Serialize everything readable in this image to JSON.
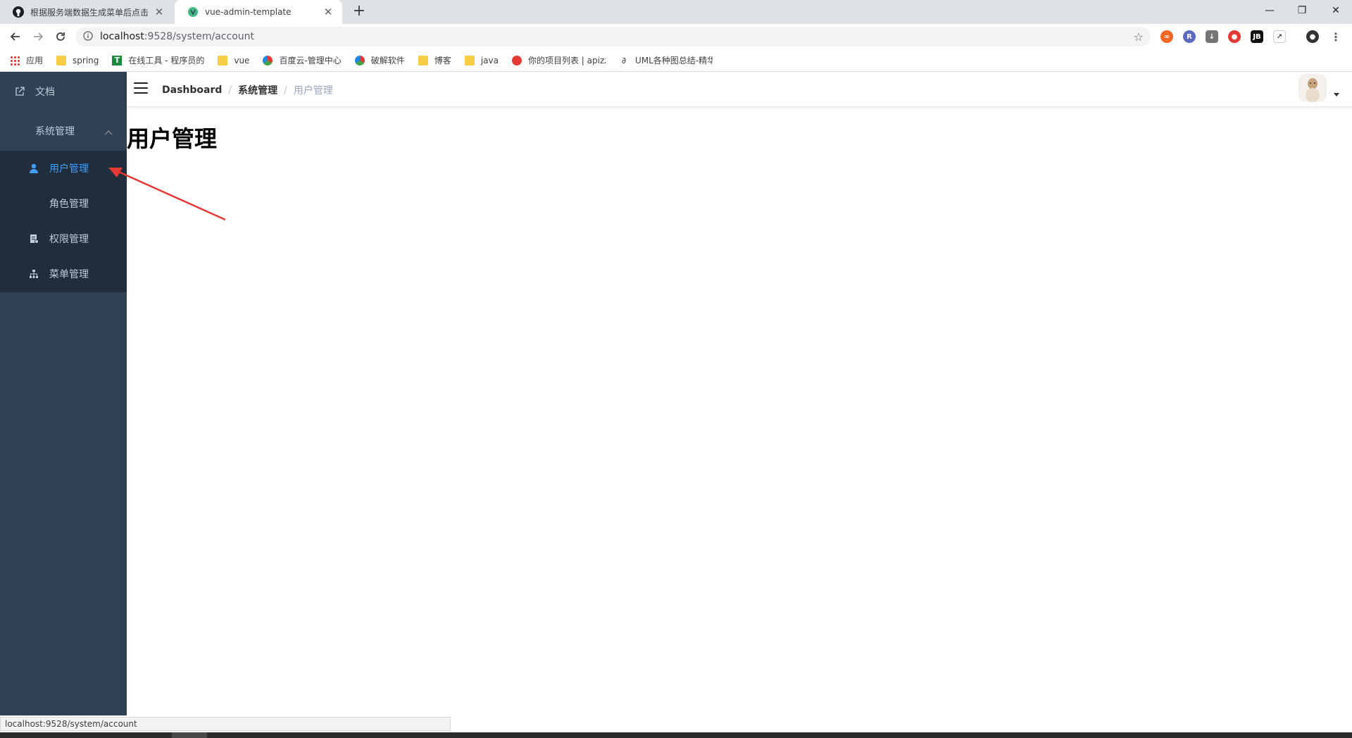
{
  "browser": {
    "tabs": [
      {
        "title": "根据服务端数据生成菜单后点击",
        "active": false
      },
      {
        "title": "vue-admin-template",
        "active": true
      }
    ],
    "url_host": "localhost",
    "url_path": ":9528/system/account",
    "bookmarks": [
      {
        "label": "应用",
        "icon": "apps-grid-icon"
      },
      {
        "label": "spring",
        "icon": "folder-icon"
      },
      {
        "label": "在线工具 - 程序员的",
        "icon": "tool-icon"
      },
      {
        "label": "vue",
        "icon": "folder-icon"
      },
      {
        "label": "百度云-管理中心",
        "icon": "baidu-cloud-icon"
      },
      {
        "label": "破解软件",
        "icon": "cloud-icon"
      },
      {
        "label": "博客",
        "icon": "folder-icon"
      },
      {
        "label": "java",
        "icon": "folder-icon"
      },
      {
        "label": "你的项目列表 | apizz",
        "icon": "apizza-icon"
      },
      {
        "label": "UML各种图总结-精华",
        "icon": "uml-icon"
      }
    ],
    "status_url": "localhost:9528/system/account"
  },
  "sidebar": {
    "items": [
      {
        "label": "文档",
        "icon": "external-link-icon"
      },
      {
        "label": "系统管理",
        "icon": "chevron-up-icon"
      },
      {
        "label": "用户管理",
        "icon": "user-icon",
        "active": true
      },
      {
        "label": "角色管理",
        "icon": ""
      },
      {
        "label": "权限管理",
        "icon": "document-icon"
      },
      {
        "label": "菜单管理",
        "icon": "tree-icon"
      }
    ]
  },
  "navbar": {
    "breadcrumb": [
      "Dashboard",
      "系统管理",
      "用户管理"
    ]
  },
  "main": {
    "title": "用户管理"
  },
  "colors": {
    "sidebar_bg": "#304156",
    "submenu_bg": "#1f2d3d",
    "active_text": "#409eff",
    "menu_text": "#bfcbd9",
    "annotation_arrow": "#e53935"
  }
}
